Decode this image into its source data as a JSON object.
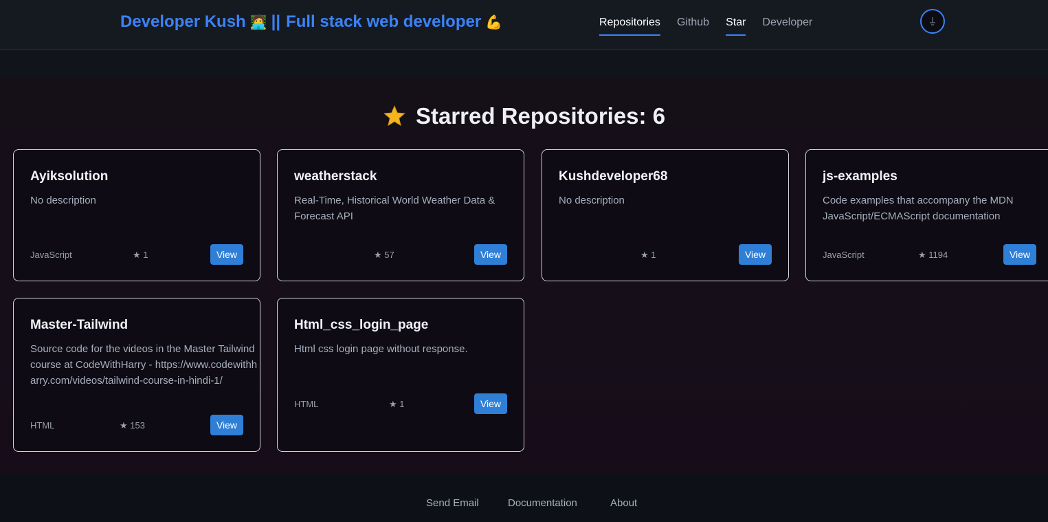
{
  "header": {
    "brand_name": "Developer Kush",
    "brand_separator": "||",
    "brand_tagline": "Full stack web developer",
    "brand_emoji_1": "🧑‍💻",
    "brand_emoji_2": "💪",
    "nav": [
      {
        "label": "Repositories",
        "active": true
      },
      {
        "label": "Github",
        "active": false
      },
      {
        "label": "Star",
        "active": true
      },
      {
        "label": "Developer",
        "active": false
      }
    ]
  },
  "main": {
    "title": "Starred Repositories: 6",
    "title_icon": "star-icon",
    "view_label": "View",
    "repos": [
      {
        "name": "Ayiksolution",
        "description": "No description",
        "language": "JavaScript",
        "stars": "★ 1"
      },
      {
        "name": "weatherstack",
        "description": "Real-Time, Historical World Weather Data & Forecast API",
        "language": "",
        "stars": "★ 57"
      },
      {
        "name": "Kushdeveloper68",
        "description": "No description",
        "language": "",
        "stars": "★ 1"
      },
      {
        "name": "js-examples",
        "description": "Code examples that accompany the MDN JavaScript/ECMAScript documentation",
        "language": "JavaScript",
        "stars": "★ 1194"
      },
      {
        "name": "Master-Tailwind",
        "description": "Source code for the videos in the Master Tailwind course at CodeWithHarry - https://www.codewithharry.com/videos/tailwind-course-in-hindi-1/",
        "language": "HTML",
        "stars": "★ 153"
      },
      {
        "name": "Html_css_login_page",
        "description": "Html css login page without response.",
        "language": "HTML",
        "stars": "★ 1"
      }
    ]
  },
  "footer": {
    "links": [
      "Send Email",
      "Documentation",
      "About"
    ]
  },
  "colors": {
    "accent": "#3b82f6",
    "button": "#2f7fd6"
  }
}
